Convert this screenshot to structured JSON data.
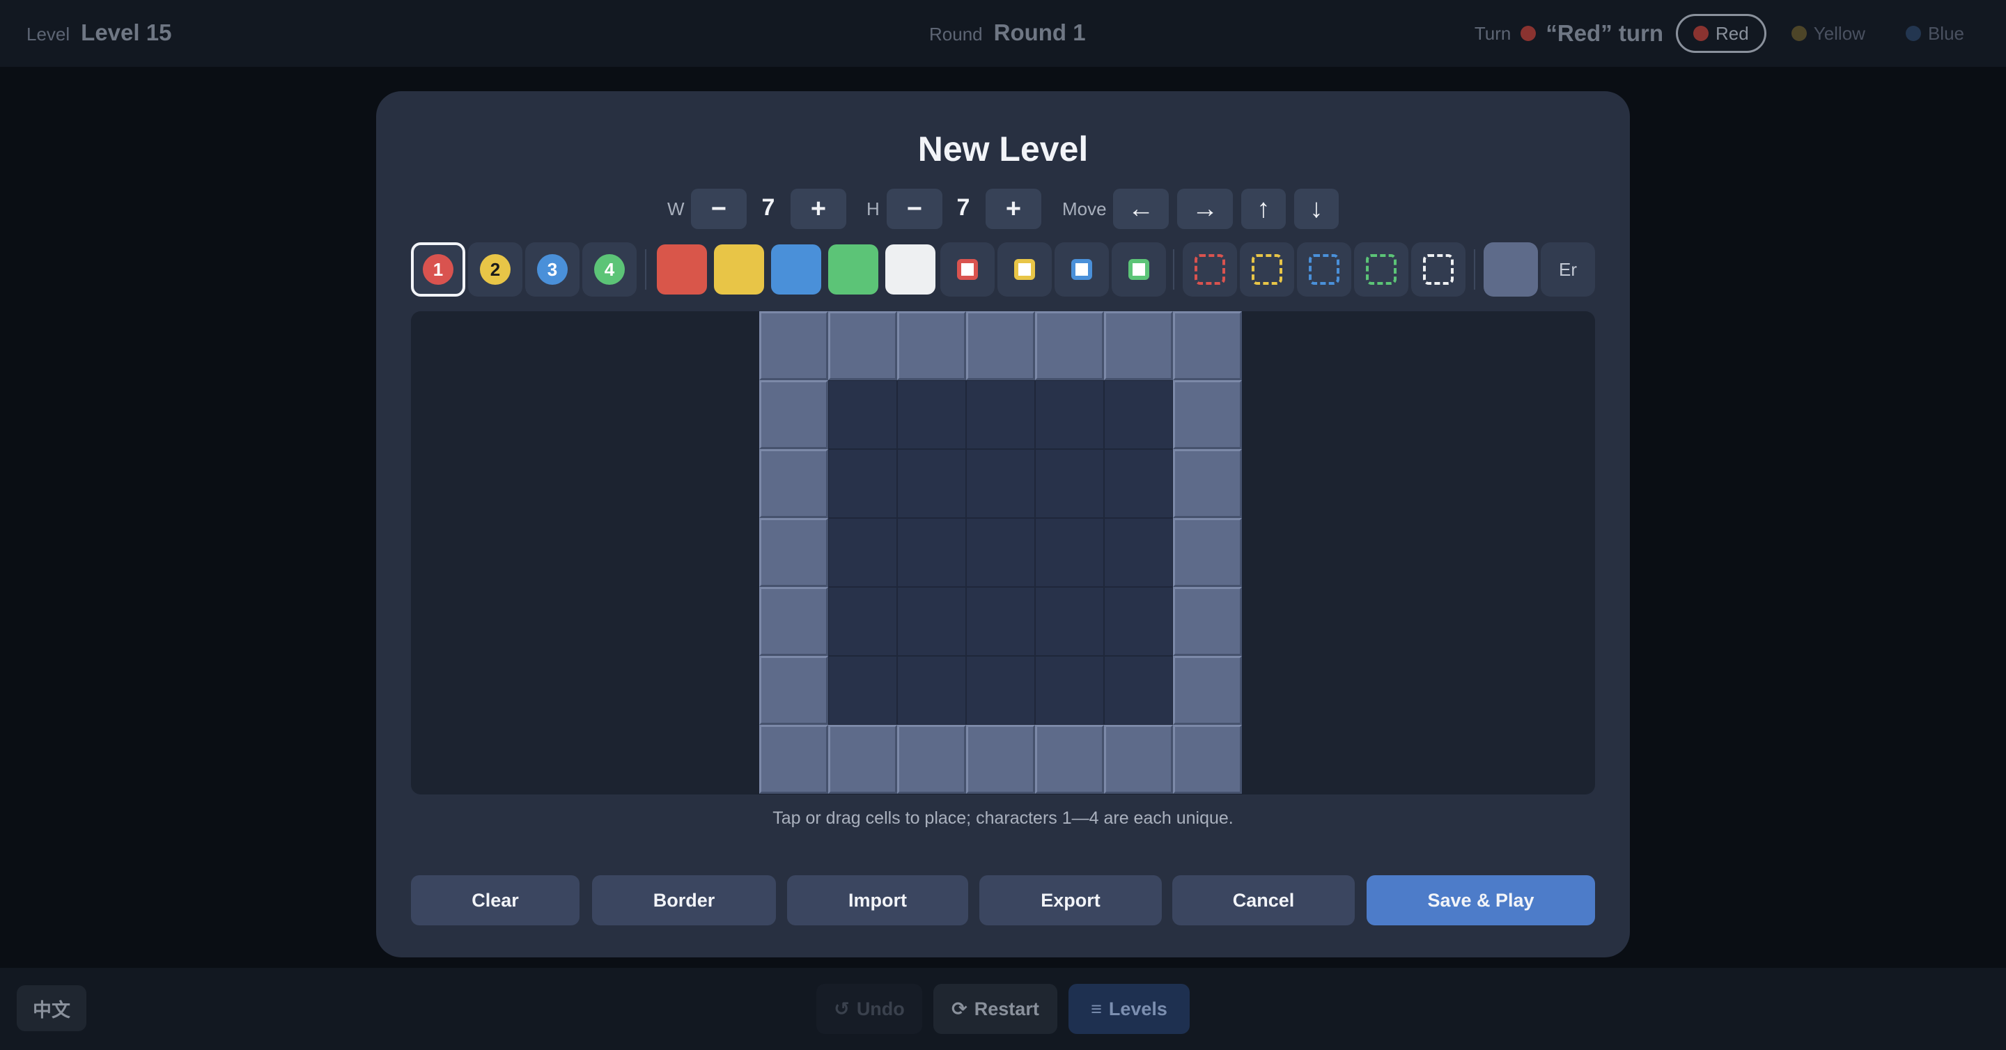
{
  "topbar": {
    "level_label": "Level",
    "level_value": "Level 15",
    "round_label": "Round",
    "round_value": "Round 1",
    "turn_label": "Turn",
    "turn_text": "“Red” turn",
    "players": [
      {
        "label": "Red",
        "color": "#d9534f",
        "active": true
      },
      {
        "label": "Yellow",
        "color": "#e8c547",
        "active": false
      },
      {
        "label": "Blue",
        "color": "#4a90d9",
        "active": false
      }
    ]
  },
  "bottombar": {
    "lang": "中文",
    "undo": "Undo",
    "restart": "Restart",
    "levels": "Levels"
  },
  "modal": {
    "title": "New Level",
    "width_label": "W",
    "width_value": "7",
    "height_label": "H",
    "height_value": "7",
    "minus": "−",
    "plus": "+",
    "move_label": "Move",
    "arrows": [
      "←",
      "→",
      "↑",
      "↓"
    ],
    "characters": [
      {
        "num": "1",
        "color": "#d9534f"
      },
      {
        "num": "2",
        "color": "#e8c547"
      },
      {
        "num": "3",
        "color": "#4a90d9"
      },
      {
        "num": "4",
        "color": "#5cc477"
      }
    ],
    "blocks": [
      "#d9564a",
      "#e8c547",
      "#4a90d9",
      "#5cc477",
      "#eef0f2"
    ],
    "targets": [
      "#d9534f",
      "#e8c547",
      "#4a90d9",
      "#5cc477"
    ],
    "zones": [
      "#d9534f",
      "#e8c547",
      "#4a90d9",
      "#5cc477",
      "#eef0f2"
    ],
    "wall_color": "#5e6b8a",
    "erase_label": "Er",
    "grid": {
      "width": 7,
      "height": 7
    },
    "hint": "Tap or drag cells to place; characters 1—4 are each unique.",
    "buttons": {
      "clear": "Clear",
      "border": "Border",
      "import": "Import",
      "export": "Export",
      "cancel": "Cancel",
      "save": "Save & Play"
    }
  }
}
